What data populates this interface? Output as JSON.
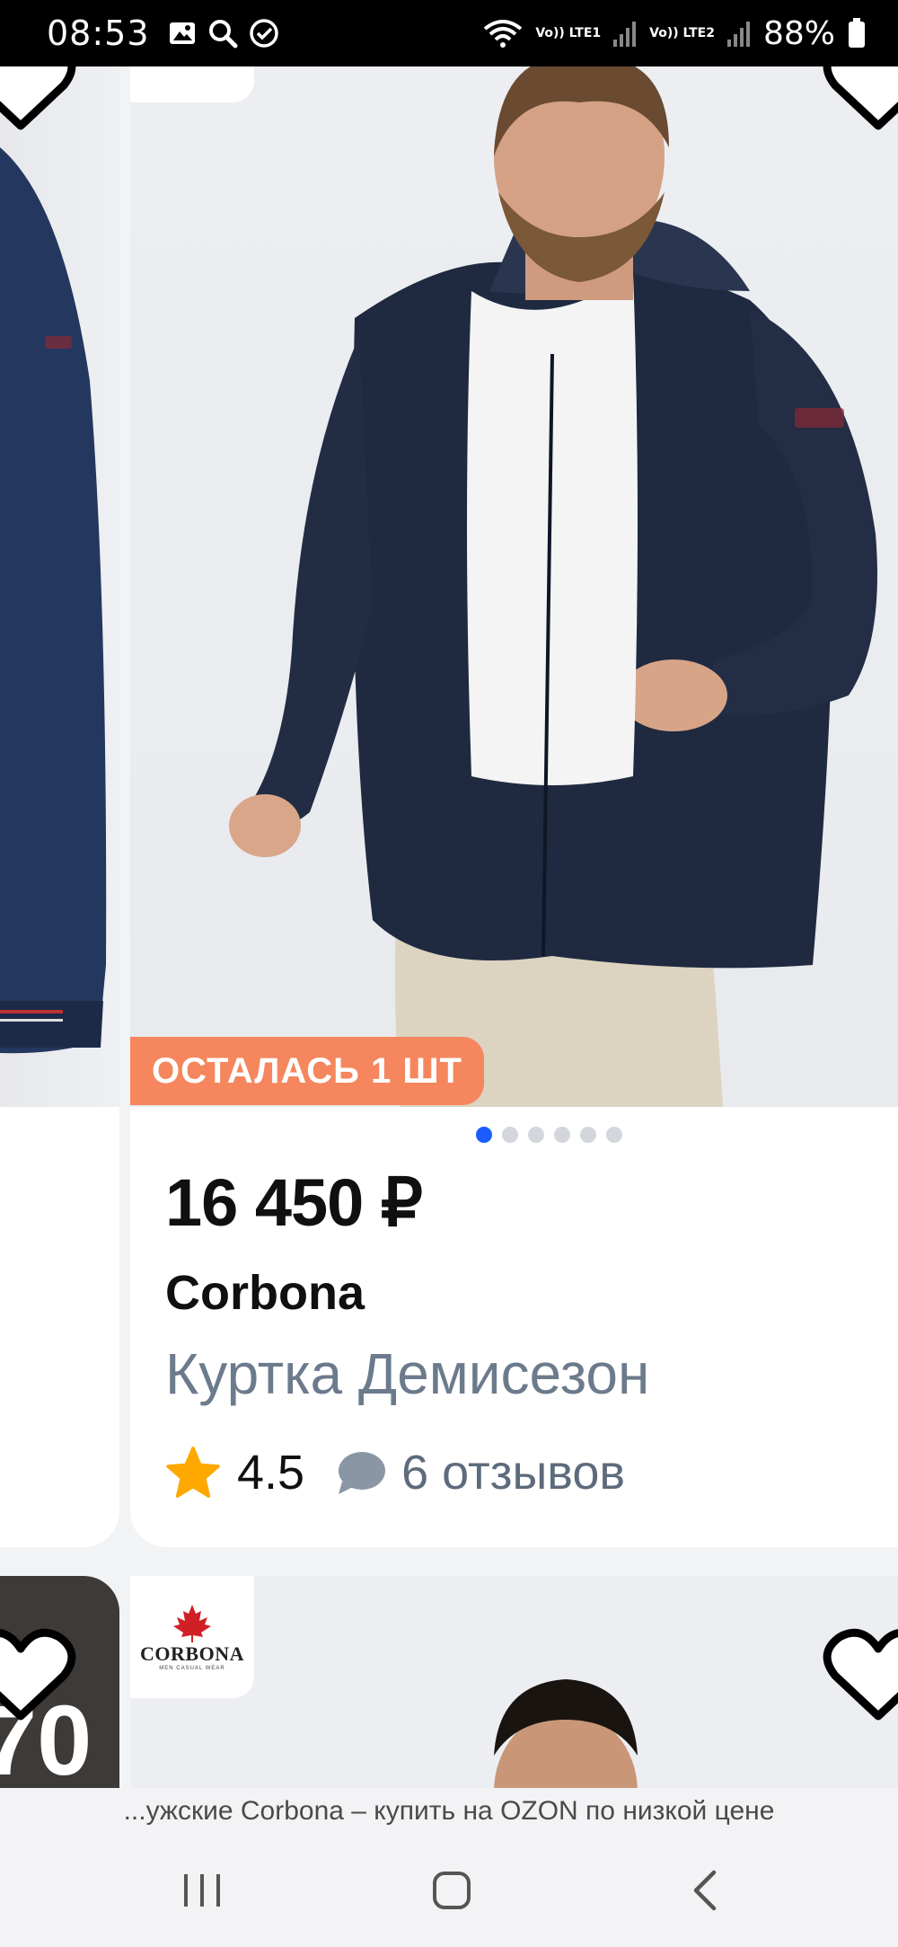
{
  "status_bar": {
    "time": "08:53",
    "network_1": "Vo)) LTE1",
    "network_2": "Vo)) LTE2",
    "battery": "88%"
  },
  "product": {
    "stock_badge": "ОСТАЛАСЬ 1 ШТ",
    "price": "16 450 ₽",
    "brand": "Corbona",
    "title": "Куртка Демисезон",
    "rating": "4.5",
    "reviews": "6 отзывов",
    "image_count": 6,
    "active_image_index": 0
  },
  "next_card": {
    "brand_logo_text": "CORBONA",
    "brand_logo_sub": "MEN CASUAL WEAR",
    "left_partial_text": "70"
  },
  "browser": {
    "page_title": "...ужские Corbona – купить на OZON по низкой цене"
  },
  "colors": {
    "badge_bg": "#f5865d",
    "dot_active": "#1a5cff",
    "star": "#ffa800",
    "title_gray": "#6c7b8c"
  }
}
